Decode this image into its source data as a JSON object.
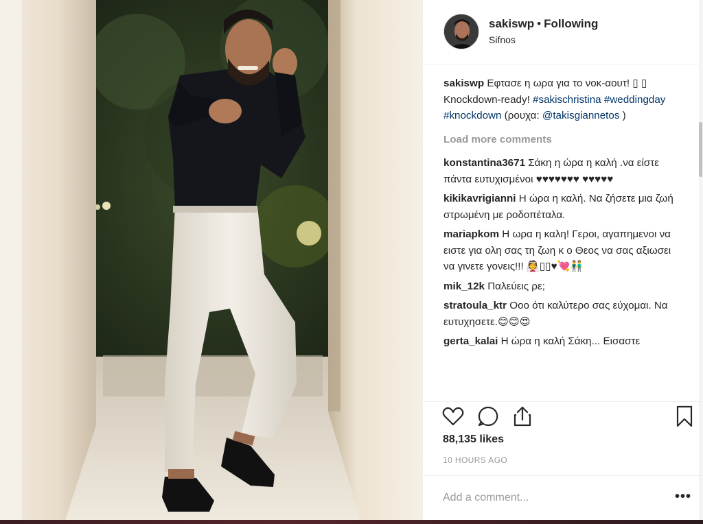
{
  "post": {
    "username": "sakiswp",
    "separator": "•",
    "follow_state": "Following",
    "location": "Sifnos"
  },
  "caption": {
    "username": "sakiswp",
    "text_part1": "Εφτασε η ωρα για το νοκ-αουτ! ▯ ▯ Knockdown-ready!",
    "hashtag1": "#sakischristina",
    "hashtag2": "#weddingday",
    "hashtag3": "#knockdown",
    "text_part2": "(ρουχα:",
    "mention": "@takisgiannetos",
    "text_part3": ")"
  },
  "load_more": "Load more comments",
  "comments": [
    {
      "user": "konstantina3671",
      "text": "Σάκη η ώρα η καλή .να είστε πάντα ευτυχισμένοι ♥♥♥♥♥♥♥ ♥♥♥♥♥"
    },
    {
      "user": "kikikavrigianni",
      "text": "Η ώρα η καλή. Να ζήσετε μια ζωή στρωμένη με ροδοπέταλα."
    },
    {
      "user": "mariapkom",
      "text": "Η ωρα η καλη! Γεροι, αγαπημενοι να ειστε για ολη σας τη ζωη κ ο Θεος να σας αξιωσει να γινετε γονεις!!! 👰▯▯♥💘👬"
    },
    {
      "user": "mik_12k",
      "text": "Παλεύεις ρε;"
    },
    {
      "user": "stratoula_ktr",
      "text": "Οοο ότι καλύτερο σας εύχομαι. Να ευτυχησετε.😊😊😍"
    },
    {
      "user": "gerta_kalai",
      "text": "Η ώρα η καλή Σάκη... Εισαστε"
    }
  ],
  "likes": "88,135 likes",
  "timestamp": "10 HOURS AGO",
  "comment_input": {
    "placeholder": "Add a comment..."
  },
  "more_options": "•••",
  "icons": {
    "like": "heart-icon",
    "comment": "speech-bubble-icon",
    "share": "share-icon",
    "save": "bookmark-icon"
  }
}
